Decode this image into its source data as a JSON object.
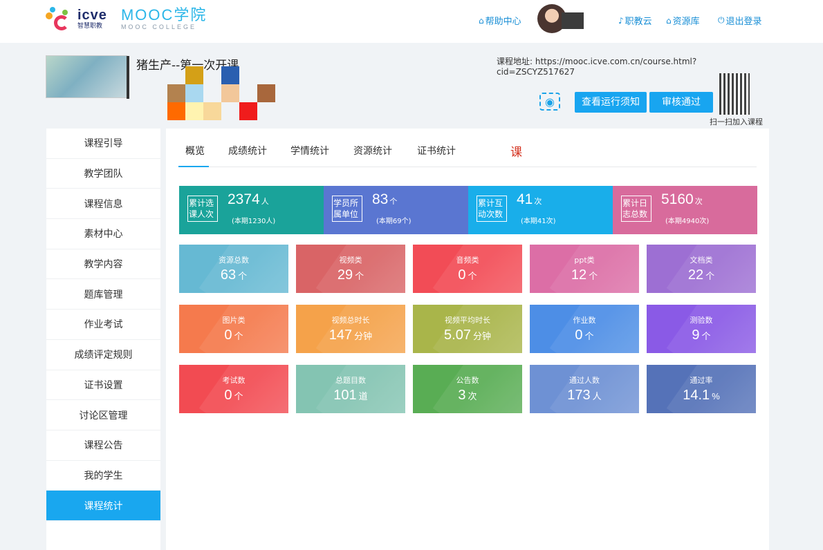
{
  "header": {
    "logo_icve": "icve",
    "logo_icve_sub": "智慧职教",
    "logo_mooc": "MOOC学院",
    "logo_mooc_sub": "MOOC COLLEGE",
    "help": "帮助中心",
    "cloud": "职教云",
    "resource": "资源库",
    "logout": "退出登录"
  },
  "course": {
    "name": "猪生产--第一次开课",
    "url_label": "课程地址:",
    "url": "https://mooc.icve.com.cn/course.html?cid=ZSCYZ517627",
    "btn_notice": "查看运行须知",
    "btn_approve": "审核通过",
    "qr_caption": "扫一扫加入课程"
  },
  "sidebar": {
    "items": [
      "课程引导",
      "教学团队",
      "课程信息",
      "素材中心",
      "教学内容",
      "题库管理",
      "作业考试",
      "成绩评定规则",
      "证书设置",
      "讨论区管理",
      "课程公告",
      "我的学生",
      "课程统计"
    ],
    "active_index": 12
  },
  "tabs": {
    "items": [
      "概览",
      "成绩统计",
      "学情统计",
      "资源统计",
      "证书统计"
    ],
    "extra": "课"
  },
  "stats": [
    {
      "label": "累计选课人次",
      "value": "2374",
      "unit": "人",
      "sub": "(本期1230人)",
      "color": "#1aa39a"
    },
    {
      "label": "学员所属单位",
      "value": "83",
      "unit": "个",
      "sub": "(本期69个)",
      "color": "#5a76d1"
    },
    {
      "label": "累计互动次数",
      "value": "41",
      "unit": "次",
      "sub": "(本期41次)",
      "color": "#19aeea"
    },
    {
      "label": "累计日志总数",
      "value": "5160",
      "unit": "次",
      "sub": "(本期4940次)",
      "color": "#d86b9c"
    }
  ],
  "tiles": [
    {
      "label": "资源总数",
      "value": "63",
      "unit": "个",
      "color": "#66b9d3"
    },
    {
      "label": "视频类",
      "value": "29",
      "unit": "个",
      "color": "#d96466"
    },
    {
      "label": "音频类",
      "value": "0",
      "unit": "个",
      "color": "#f24c56"
    },
    {
      "label": "ppt类",
      "value": "12",
      "unit": "个",
      "color": "#dc6ea6"
    },
    {
      "label": "文档类",
      "value": "22",
      "unit": "个",
      "color": "#9d6fd3"
    },
    {
      "label": "图片类",
      "value": "0",
      "unit": "个",
      "color": "#f57a4d"
    },
    {
      "label": "视频总时长",
      "value": "147",
      "unit": "分钟",
      "color": "#f5a24a"
    },
    {
      "label": "视频平均时长",
      "value": "5.07",
      "unit": "分钟",
      "color": "#a9b54a"
    },
    {
      "label": "作业数",
      "value": "0",
      "unit": "个",
      "color": "#4d8ee6"
    },
    {
      "label": "测验数",
      "value": "9",
      "unit": "个",
      "color": "#8a5ae6"
    },
    {
      "label": "考试数",
      "value": "0",
      "unit": "个",
      "color": "#f24b52"
    },
    {
      "label": "总题目数",
      "value": "101",
      "unit": "道",
      "color": "#84c4b2"
    },
    {
      "label": "公告数",
      "value": "3",
      "unit": "次",
      "color": "#59ad54"
    },
    {
      "label": "通过人数",
      "value": "173",
      "unit": "人",
      "color": "#6e91d4"
    },
    {
      "label": "通过率",
      "value": "14.1",
      "unit": "%",
      "color": "#5572b8"
    }
  ]
}
